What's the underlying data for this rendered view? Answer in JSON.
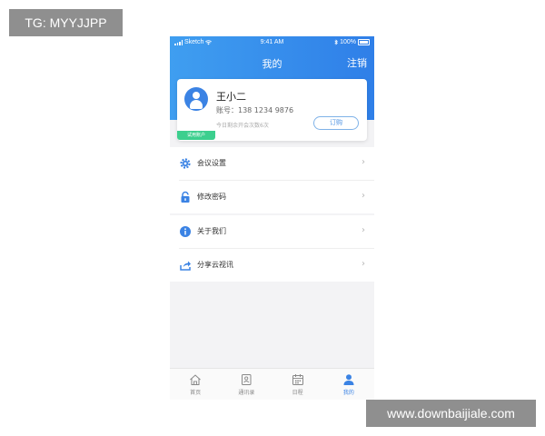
{
  "watermarks": {
    "top": "TG: MYYJJPP",
    "bottom": "www.downbaijiale.com"
  },
  "status_bar": {
    "carrier": "Sketch",
    "time": "9:41 AM",
    "battery": "100%"
  },
  "nav": {
    "title": "我的",
    "logout_label": "注销"
  },
  "profile": {
    "name": "王小二",
    "phone": "账号：138 1234 9876",
    "remaining": "今日剩余开会次数6次",
    "subscribe_label": "订购",
    "badge": "试用账户"
  },
  "menu_group_1": [
    {
      "label": "会议设置",
      "icon": "gear-icon"
    },
    {
      "label": "修改密码",
      "icon": "lock-icon"
    }
  ],
  "menu_group_2": [
    {
      "label": "关于我们",
      "icon": "info-icon"
    },
    {
      "label": "分享云视讯",
      "icon": "share-icon"
    }
  ],
  "tabbar": [
    {
      "label": "首页",
      "icon": "home-icon"
    },
    {
      "label": "通讯录",
      "icon": "contacts-icon"
    },
    {
      "label": "日程",
      "icon": "calendar-icon"
    },
    {
      "label": "我的",
      "icon": "person-icon",
      "active": true
    }
  ],
  "colors": {
    "accent": "#3b83e4",
    "header_start": "#3f9ef0",
    "header_end": "#2f7fe8",
    "trial_badge": "#3ccf8e"
  }
}
